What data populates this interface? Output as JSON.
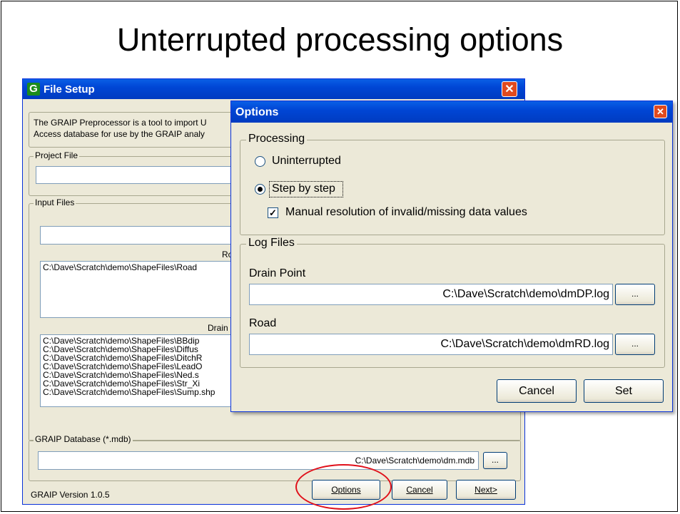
{
  "slide": {
    "title": "Unterrupted processing options"
  },
  "file_setup": {
    "title": "File Setup",
    "app_icon_letter": "G",
    "intro_line1": "The GRAIP Preprocessor is a tool to import U",
    "intro_line2": "Access database for use by the GRAIP analy",
    "project_file_label": "Project File",
    "project_file_value": "",
    "input_files_label": "Input Files",
    "input_file_value": "",
    "road_label": "Ro",
    "road_list": [
      "C:\\Dave\\Scratch\\demo\\ShapeFiles\\Road"
    ],
    "drain_label": "Drain",
    "drain_list": [
      "C:\\Dave\\Scratch\\demo\\ShapeFiles\\BBdip",
      "C:\\Dave\\Scratch\\demo\\ShapeFiles\\Diffus",
      "C:\\Dave\\Scratch\\demo\\ShapeFiles\\DitchR",
      "C:\\Dave\\Scratch\\demo\\ShapeFiles\\LeadO",
      "C:\\Dave\\Scratch\\demo\\ShapeFiles\\Ned.s",
      "C:\\Dave\\Scratch\\demo\\ShapeFiles\\Str_Xi",
      "C:\\Dave\\Scratch\\demo\\ShapeFiles\\Sump.shp"
    ],
    "database_label": "GRAIP Database (*.mdb)",
    "database_value": "C:\\Dave\\Scratch\\demo\\dm.mdb",
    "browse_label": "...",
    "version": "GRAIP Version 1.0.5",
    "options_label": "Options",
    "cancel_label": "Cancel",
    "next_label": "Next>"
  },
  "options_dialog": {
    "title": "Options",
    "processing_label": "Processing",
    "uninterrupted_label": "Uninterrupted",
    "step_label": "Step by step",
    "selected": "step",
    "manual_label": "Manual resolution of invalid/missing data values",
    "manual_checked": true,
    "log_files_label": "Log Files",
    "drain_point_label": "Drain Point",
    "drain_point_value": "C:\\Dave\\Scratch\\demo\\dmDP.log",
    "road_label": "Road",
    "road_value": "C:\\Dave\\Scratch\\demo\\dmRD.log",
    "browse_label": "...",
    "cancel_label": "Cancel",
    "set_label": "Set"
  },
  "icons": {
    "close": "close-x",
    "checkmark": "checkmark",
    "scroll_down": "chevron-down"
  },
  "colors": {
    "titlebar": "#0046d5",
    "window_face": "#ece9d8",
    "close_button": "#e04a1f",
    "highlight_ellipse": "#e0101a"
  }
}
